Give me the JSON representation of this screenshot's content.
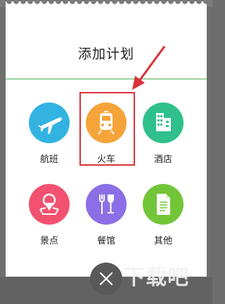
{
  "dialog": {
    "title": "添加计划",
    "accent_color": "#4caf50"
  },
  "options": [
    {
      "label": "航班",
      "icon": "airplane-icon",
      "color": "#33b3e2"
    },
    {
      "label": "火车",
      "icon": "train-icon",
      "color": "#f5a43a"
    },
    {
      "label": "酒店",
      "icon": "hotel-building-icon",
      "color": "#2fc08c"
    },
    {
      "label": "景点",
      "icon": "landmark-pin-icon",
      "color": "#f2526f"
    },
    {
      "label": "餐馆",
      "icon": "fork-wine-glass-icon",
      "color": "#8c6fe6"
    },
    {
      "label": "其他",
      "icon": "document-icon",
      "color": "#73c538"
    }
  ],
  "annotation": {
    "highlight_color": "#d9323a"
  },
  "close_button": {
    "icon": "close-icon"
  },
  "watermark": {
    "text": "下载吧"
  }
}
